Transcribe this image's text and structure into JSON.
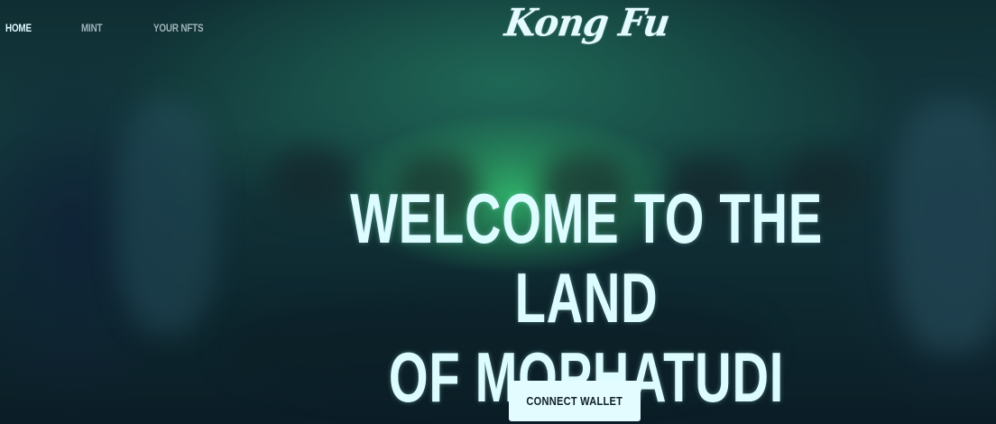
{
  "nav": {
    "items": [
      {
        "label": "HOME",
        "active": true
      },
      {
        "label": "MINT",
        "active": false
      },
      {
        "label": "YOUR NFTS",
        "active": false
      }
    ]
  },
  "brand": {
    "logo_text": "Kong Fu"
  },
  "hero": {
    "title_line1": "WELCOME TO THE LAND",
    "title_line2": "OF MOPHATUDI"
  },
  "cta": {
    "connect_label": "CONNECT WALLET"
  },
  "colors": {
    "text_primary": "#dcfcff",
    "nav_inactive": "#9fb3bb",
    "button_bg": "#e3fcff",
    "button_text": "#112028",
    "accent_glow": "#34be6e"
  }
}
